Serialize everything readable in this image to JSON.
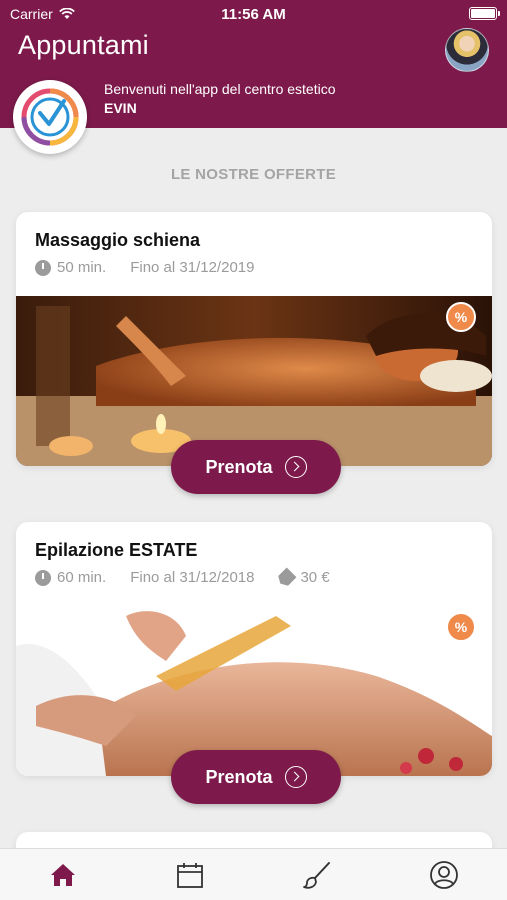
{
  "status_bar": {
    "carrier": "Carrier",
    "time": "11:56 AM"
  },
  "header": {
    "title": "Appuntami",
    "welcome_line": "Benvenuti nell'app del centro estetico",
    "center_name": "EVIN",
    "accent_color": "#7d1a4b"
  },
  "section": {
    "title": "LE NOSTRE OFFERTE"
  },
  "offers": [
    {
      "title": "Massaggio schiena",
      "duration": "50 min.",
      "valid_until": "Fino al 31/12/2019",
      "price": "",
      "badge": "%",
      "button_label": "Prenota"
    },
    {
      "title": "Epilazione ESTATE",
      "duration": "60 min.",
      "valid_until": "Fino al 31/12/2018",
      "price": "30 €",
      "badge": "%",
      "button_label": "Prenota"
    }
  ],
  "tabbar": {
    "items": [
      "home-icon",
      "calendar-icon",
      "brush-icon",
      "profile-icon"
    ],
    "active": "home-icon"
  }
}
